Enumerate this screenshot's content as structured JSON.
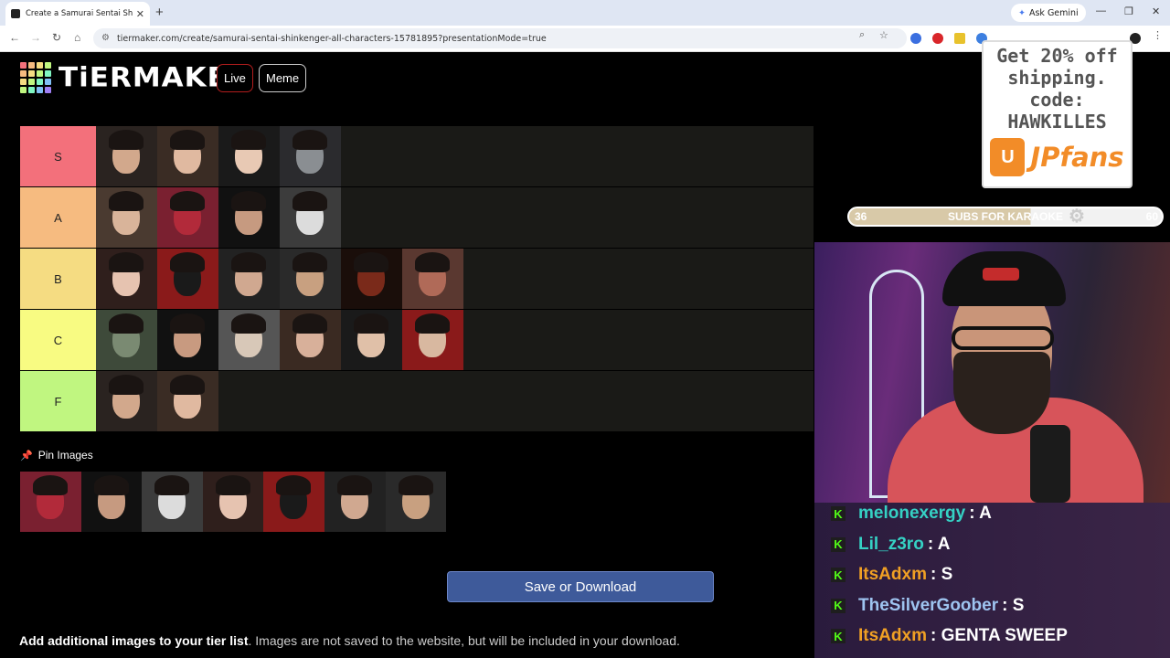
{
  "browser": {
    "tab_title": "Create a Samurai Sentai Shinke",
    "ask_gemini": "Ask Gemini",
    "url": "tiermaker.com/create/samurai-sentai-shinkenger-all-characters-15781895?presentationMode=true"
  },
  "header": {
    "logo_text": "TiERMAKER",
    "live_label": "Live",
    "meme_label": "Meme"
  },
  "tiers": [
    {
      "label": "S",
      "color": "#f3707b",
      "count": 4
    },
    {
      "label": "A",
      "color": "#f6bb80",
      "count": 4
    },
    {
      "label": "B",
      "color": "#f5dc82",
      "count": 6
    },
    {
      "label": "C",
      "color": "#f8fb82",
      "count": 6
    },
    {
      "label": "F",
      "color": "#c0f680",
      "count": 2
    }
  ],
  "pin": {
    "header": "Pin Images",
    "count": 7
  },
  "save_label": "Save or Download",
  "add_images": {
    "bold": "Add additional images to your tier list",
    "rest": ". Images are not saved to the website, but will be included in your download."
  },
  "overlay": {
    "ad_line1": "Get 20% off",
    "ad_line2": "shipping.",
    "ad_line3": "code:",
    "ad_line4": "HAWKILLES",
    "ad_brand": "JPfans",
    "ad_bag": "U",
    "sub_min": "36",
    "sub_label": "SUBS FOR KARAOKE",
    "sub_max": "60"
  },
  "chat": [
    {
      "user": "melonexergy",
      "color": "#35d1c4",
      "msg": ": A"
    },
    {
      "user": "Lil_z3ro",
      "color": "#35d1c4",
      "msg": ": A"
    },
    {
      "user": "ItsAdxm",
      "color": "#f0a024",
      "msg": ": S"
    },
    {
      "user": "TheSilverGoober",
      "color": "#9ec4f0",
      "msg": ": S"
    },
    {
      "user": "ItsAdxm",
      "color": "#f0a024",
      "msg": ": GENTA SWEEP"
    }
  ]
}
